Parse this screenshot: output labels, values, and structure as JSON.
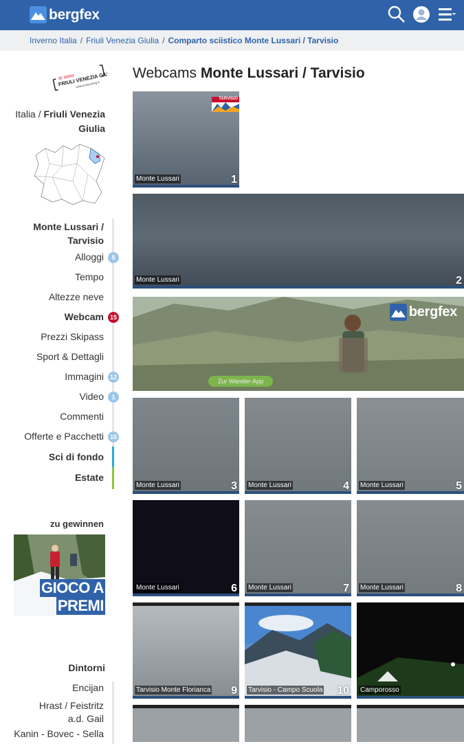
{
  "header": {
    "brand": "bergfex",
    "icons": [
      "search-icon",
      "user-icon",
      "menu-icon"
    ]
  },
  "breadcrumb": [
    {
      "label": "Inverno Italia"
    },
    {
      "label": "Friuli Venezia Giulia"
    },
    {
      "label": "Comparto sciistico Monte Lussari / Tarvisio"
    }
  ],
  "region": {
    "logo_text_1": "io sono",
    "logo_text_2": "FRIULI VENEZIA GIULIA",
    "logo_text_3": "www.turismofvg.it",
    "country": "Italia",
    "separator": "/",
    "name": "Friuli Venezia Giulia"
  },
  "nav": {
    "items": [
      {
        "label": "Monte Lussari / Tarvisio",
        "badge": "",
        "bold": true
      },
      {
        "label": "Alloggi",
        "badge": "5"
      },
      {
        "label": "Tempo",
        "badge": ""
      },
      {
        "label": "Altezze neve",
        "badge": ""
      },
      {
        "label": "Webcam",
        "badge": "15",
        "bold": true
      },
      {
        "label": "Prezzi Skipass",
        "badge": ""
      },
      {
        "label": "Sport & Dettagli",
        "badge": ""
      },
      {
        "label": "Immagini",
        "badge": "12"
      },
      {
        "label": "Video",
        "badge": "1"
      },
      {
        "label": "Commenti",
        "badge": ""
      },
      {
        "label": "Offerte e Pacchetti",
        "badge": "10"
      },
      {
        "label": "Sci di fondo",
        "badge": "",
        "bold": true
      },
      {
        "label": "Estate",
        "badge": "",
        "bold": true
      }
    ],
    "colors": {
      "badge": "#9cc5e8",
      "badge_active": "#c8102e",
      "rail_fondo": "#29aae1",
      "rail_estate": "#8cc63f"
    }
  },
  "promo": {
    "label": "zu gewinnen",
    "title_1": "GIOCO A",
    "title_2": "PREMI"
  },
  "nearby": {
    "title": "Dintorni",
    "items": [
      "Encijan",
      "Hrast / Feistritz a.d. Gail",
      "Kanin - Bovec - Sella"
    ]
  },
  "main": {
    "title_prefix": "Webcams",
    "title_bold": "Monte Lussari / Tarvisio",
    "ad": {
      "brand": "bergfex",
      "button": "Zur Wander-App"
    },
    "webcams": [
      {
        "label": "Monte Lussari",
        "num": "1",
        "overlay": "TARVISIO"
      },
      {
        "label": "Monte Lussari",
        "num": "2"
      },
      {
        "label": "Monte Lussari",
        "num": "3"
      },
      {
        "label": "Monte Lussari",
        "num": "4"
      },
      {
        "label": "Monte Lussari",
        "num": "5"
      },
      {
        "label": "Monte Lussari",
        "num": "6"
      },
      {
        "label": "Monte Lussari",
        "num": "7"
      },
      {
        "label": "Monte Lussari",
        "num": "8"
      },
      {
        "label": "Tarvisio Monte Florianca",
        "num": "9"
      },
      {
        "label": "Tarvisio - Campo Scuola",
        "num": "10"
      },
      {
        "label": "Camporosso",
        "num": "11"
      }
    ]
  },
  "colors": {
    "brand": "#2f62a8",
    "crumb_bg": "#eef0f2"
  }
}
